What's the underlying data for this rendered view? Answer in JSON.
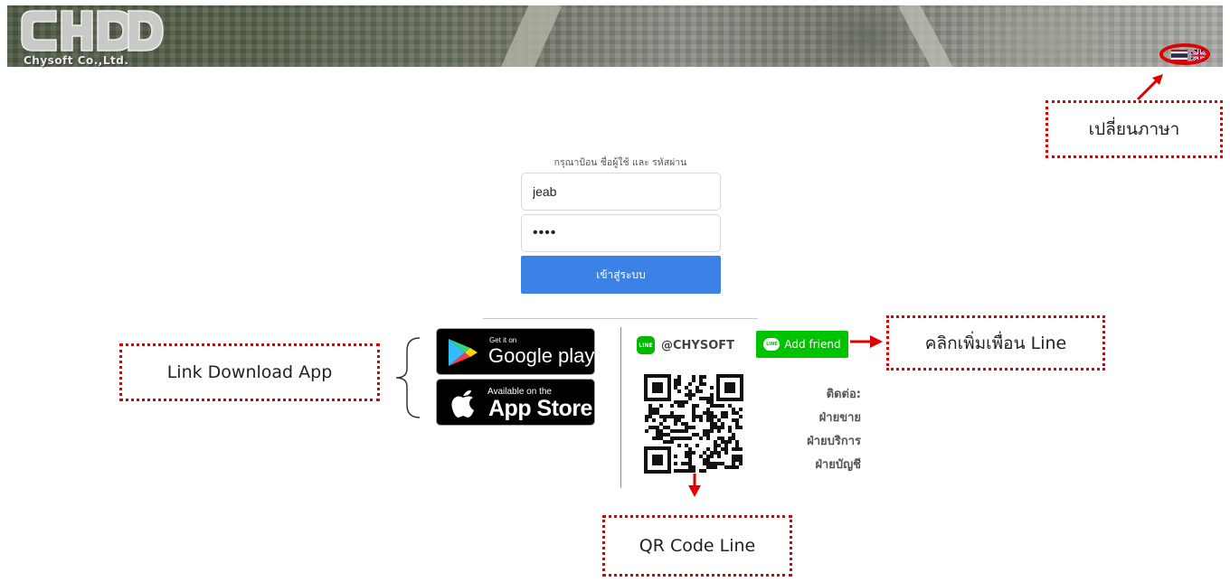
{
  "header": {
    "logo_text": "Chysoft Co.,Ltd.",
    "language_flags": [
      "thai-flag-icon",
      "uk-flag-icon"
    ]
  },
  "login": {
    "prompt": "กรุณาป้อน ชื่อผู้ใช้ และ รหัสผ่าน",
    "username": "jeab",
    "password_mask": "••••",
    "submit_label": "เข้าสู่ระบบ"
  },
  "badges": {
    "google": {
      "small": "Get it on",
      "big": "Google play"
    },
    "apple": {
      "small": "Available on the",
      "big": "App Store"
    }
  },
  "line": {
    "logo": "LINE",
    "id": "@CHYSOFT",
    "add_friend_label": "Add friend"
  },
  "contact": {
    "title": "ติดต่อ:",
    "sales": "ฝ่ายขาย",
    "service": "ฝ่ายบริการ",
    "accounting": "ฝ่ายบัญชี"
  },
  "annotations": {
    "change_language": "เปลี่ยนภาษา",
    "download_app": "Link Download App",
    "add_line_friend": "คลิกเพิ่มเพื่อน Line",
    "qr_code": "QR Code Line",
    "accent_color": "#e10000"
  },
  "colors": {
    "login_button": "#3c82e6",
    "line_green": "#00c300"
  }
}
